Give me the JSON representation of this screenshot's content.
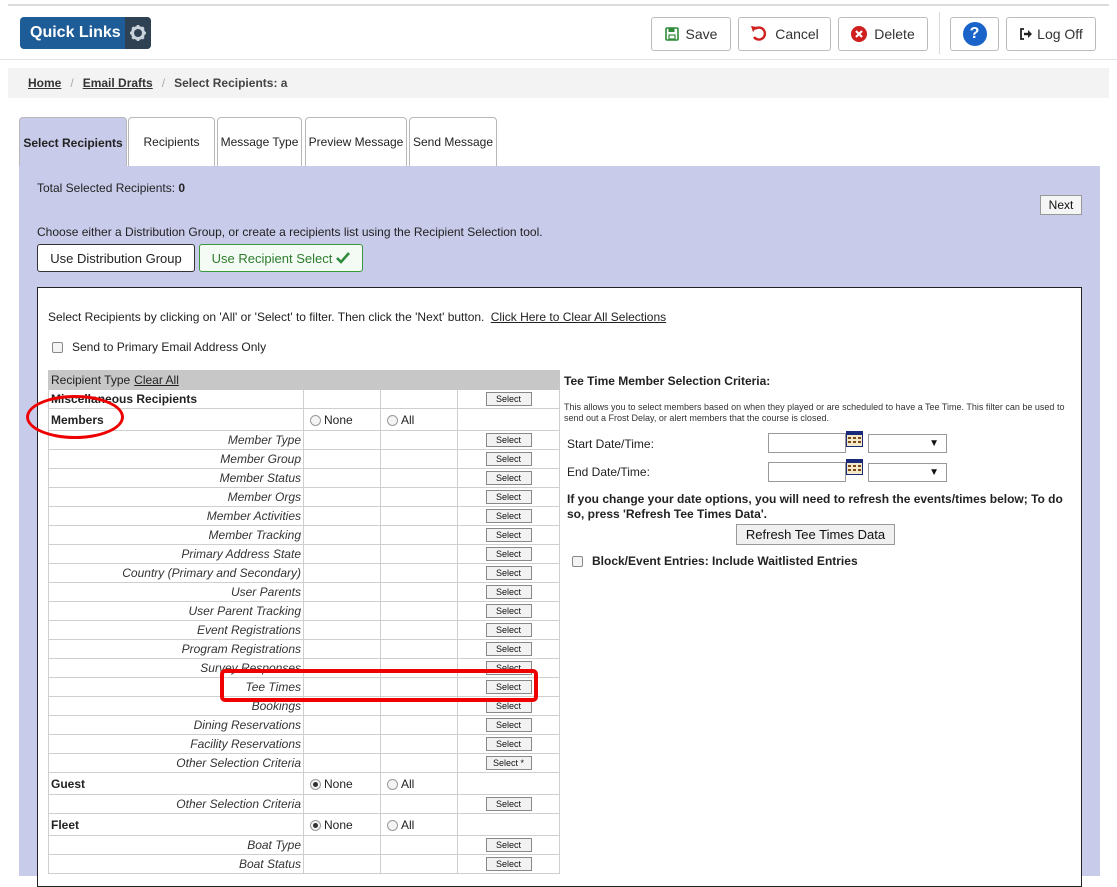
{
  "header": {
    "quick_links": "Quick Links",
    "save": "Save",
    "cancel": "Cancel",
    "delete": "Delete",
    "help": "?",
    "log_off": "Log Off"
  },
  "breadcrumb": {
    "home": "Home",
    "email_drafts": "Email Drafts",
    "current": "Select Recipients: a",
    "separator": "/"
  },
  "tabs": [
    "Select Recipients",
    "Recipients",
    "Message Type",
    "Preview Message",
    "Send Message"
  ],
  "summary": {
    "total_label": "Total Selected Recipients:",
    "total_value": "0",
    "next": "Next",
    "choose_text": "Choose either a Distribution Group, or create a recipients list using the Recipient Selection tool.",
    "use_distribution_group": "Use Distribution Group",
    "use_recipient_select": "Use Recipient Select"
  },
  "recipients": {
    "instructions": "Select Recipients by clicking on 'All' or 'Select' to filter. Then click the 'Next' button.",
    "clear_all_selections": "Click Here to Clear All Selections",
    "primary_only": "Send to Primary Email Address Only",
    "type_header": "Recipient Type",
    "clear_all": "Clear All",
    "misc": "Miscellaneous Recipients",
    "none": "None",
    "all": "All",
    "select": "Select",
    "select_star": "Select *",
    "groups": {
      "members": "Members",
      "guest": "Guest",
      "fleet": "Fleet"
    },
    "member_rows": [
      "Member Type",
      "Member Group",
      "Member Status",
      "Member Orgs",
      "Member Activities",
      "Member Tracking",
      "Primary Address State",
      "Country (Primary and Secondary)",
      "User Parents",
      "User Parent Tracking",
      "Event Registrations",
      "Program Registrations",
      "Survey Responses",
      "Tee Times",
      "Bookings",
      "Dining Reservations",
      "Facility Reservations",
      "Other Selection Criteria"
    ],
    "guest_rows": [
      "Other Selection Criteria"
    ],
    "fleet_rows": [
      "Boat Type",
      "Boat Status"
    ]
  },
  "tee_times": {
    "title": "Tee Time Member Selection Criteria:",
    "description": "This allows you to select members based on when they played or are scheduled to have a Tee Time. This filter can be used to send out a Frost Delay, or alert members that the course is closed.",
    "start": "Start Date/Time:",
    "end": "End Date/Time:",
    "note": "If you change your date options, you will need to refresh the events/times below; To do so, press 'Refresh Tee Times Data'.",
    "refresh": "Refresh Tee Times Data",
    "waitlist": "Block/Event Entries: Include Waitlisted Entries"
  }
}
